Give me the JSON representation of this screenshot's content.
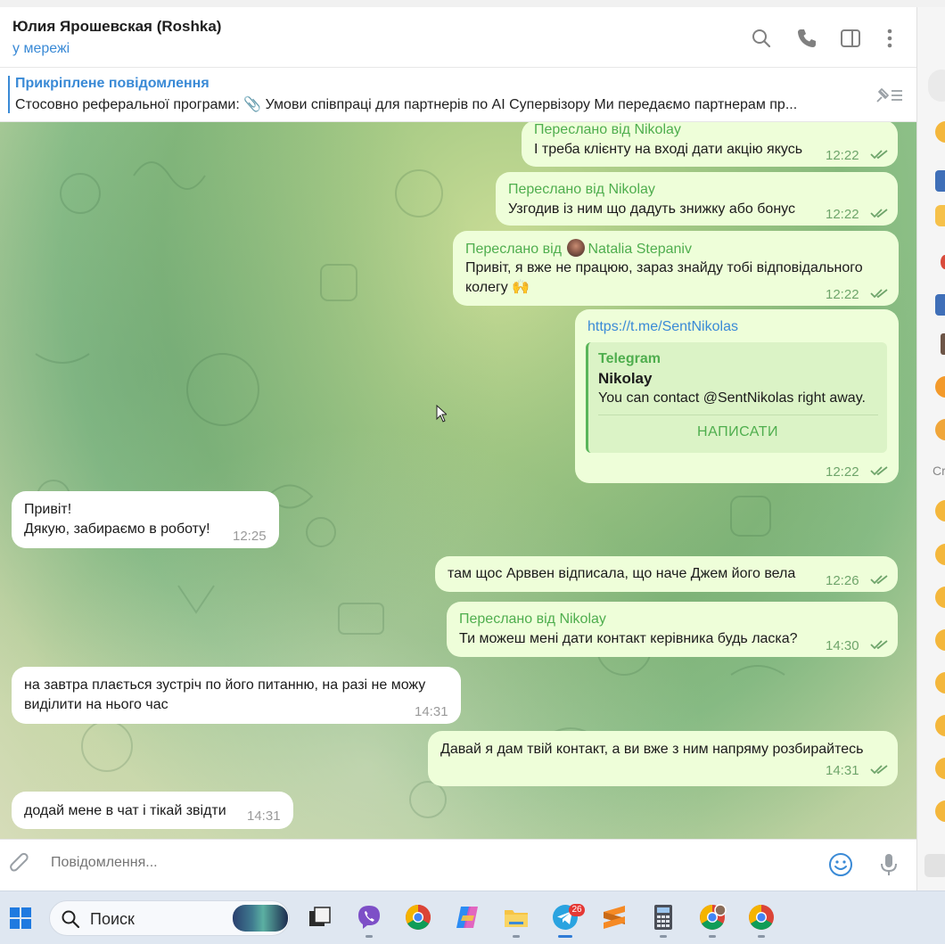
{
  "header": {
    "title": "Юлия Ярошевская (Roshka)",
    "status": "у мережі",
    "icons": [
      "search-icon",
      "phone-icon",
      "sidebar-toggle-icon",
      "more-icon"
    ]
  },
  "pinned": {
    "title": "Прикріплене повідомлення",
    "text": "Стосовно реферальної програми: 📎 Умови співпраці для партнерів по AI Супервізору Ми передаємо партнерам пр..."
  },
  "messages": [
    {
      "dir": "out",
      "forward": "Переслано від Nikolay",
      "text": "І треба клієнту на вході дати акцію якусь",
      "time": "12:22"
    },
    {
      "dir": "out",
      "forward": "Переслано від Nikolay",
      "text": "Узгодив із ним що дадуть знижку або бонус",
      "time": "12:22"
    },
    {
      "dir": "out",
      "forward_prefix": "Переслано від",
      "forward_name": "Natalia Stepaniv",
      "text_line1": "Привіт, я вже не працюю, зараз знайду тобі відповідального",
      "text_line2": "колегу 🙌",
      "time": "12:22"
    },
    {
      "dir": "out",
      "link": "https://t.me/SentNikolas",
      "preview": {
        "site": "Telegram",
        "title": "Nikolay",
        "description": "You can contact @SentNikolas right away.",
        "button": "НАПИСАТИ"
      },
      "time": "12:22"
    },
    {
      "dir": "in",
      "text_line1": "Привіт!",
      "text_line2": "Дякую, забираємо в роботу!",
      "time": "12:25"
    },
    {
      "dir": "out",
      "text": "там щос Арввен відписала, що наче Джем його вела",
      "time": "12:26"
    },
    {
      "dir": "out",
      "forward": "Переслано від Nikolay",
      "text": "Ти можеш мені дати контакт керівника будь ласка?",
      "time": "14:30"
    },
    {
      "dir": "in",
      "text_line1": "на завтра плається зустріч по його питанню, на разі не можу",
      "text_line2": "виділити на нього час",
      "time": "14:31"
    },
    {
      "dir": "out",
      "text": "Давай я дам твій контакт, а ви вже з ним напряму розбирайтесь",
      "time": "14:31"
    },
    {
      "dir": "in",
      "text": "додай мене в чат і тікай звідти",
      "time": "14:31"
    }
  ],
  "composer": {
    "placeholder": "Повідомлення..."
  },
  "side_panel": {
    "label": "Cr"
  },
  "taskbar": {
    "search_label": "Поиск",
    "telegram_badge": "26",
    "apps": [
      "windows-start",
      "search",
      "task-view",
      "viber",
      "chrome",
      "copilot",
      "file-explorer",
      "telegram",
      "sublime-text",
      "calculator",
      "chrome-profile",
      "chrome"
    ]
  },
  "colors": {
    "accent": "#3a8ad6",
    "outgoing_bubble": "#eefed9",
    "forward_green": "#4fae4e",
    "incoming_bubble": "#ffffff"
  }
}
